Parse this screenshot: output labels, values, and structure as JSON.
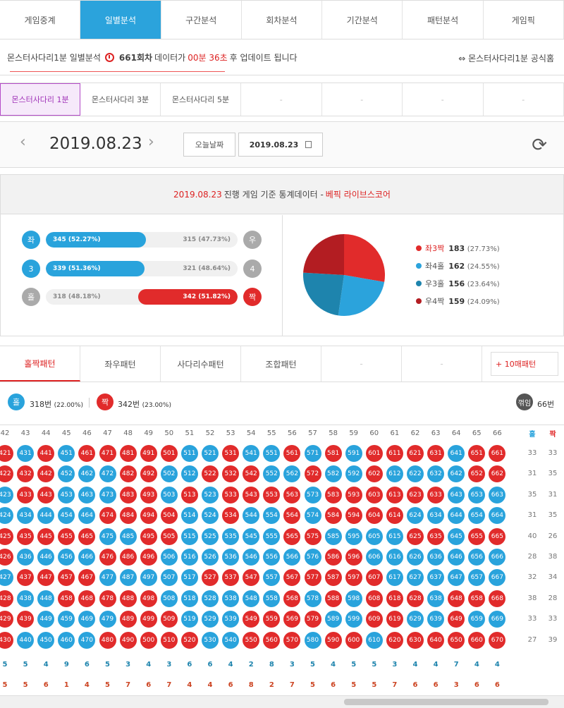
{
  "tabs": [
    "게임중계",
    "일별분석",
    "구간분석",
    "회차분석",
    "기간분석",
    "패턴분석",
    "게임픽"
  ],
  "active_tab": 1,
  "notice": {
    "prefix": "몬스터사다리1분 일별분석",
    "round": "661회차",
    "mid": "데이터가",
    "time": "00분 36초",
    "suffix": "후 업데이트 됩니다",
    "home": "몬스터사다리1분 공식홈"
  },
  "ladders": [
    "몬스터사다리 1분",
    "몬스터사다리 3분",
    "몬스터사다리 5분",
    "-",
    "-",
    "-",
    "-"
  ],
  "date": {
    "current": "2019.08.23",
    "today_button": "오늘날짜",
    "picker_value": "2019.08.23"
  },
  "stats": {
    "head_date": "2019.08.23",
    "head_text": "진행 게임 기준 통계데이터 -",
    "head_brand": "베픽 라이브스코어",
    "rows": [
      {
        "left_label": "좌",
        "right_label": "우",
        "left_text": "345 (52.27%)",
        "right_text": "315 (47.73%)",
        "left_pct": 52.27,
        "winner": "left",
        "color": "#29a3dc"
      },
      {
        "left_label": "3",
        "right_label": "4",
        "left_text": "339 (51.36%)",
        "right_text": "321 (48.64%)",
        "left_pct": 51.36,
        "winner": "left",
        "color": "#29a3dc"
      },
      {
        "left_label": "홀",
        "right_label": "짝",
        "left_text": "318 (48.18%)",
        "right_text": "342 (51.82%)",
        "left_pct": 48.18,
        "winner": "right",
        "color": "#e12b2b"
      }
    ],
    "legend": [
      {
        "label": "좌3짝",
        "value": "183",
        "pct": "(27.73%)",
        "color": "#e12b2b",
        "share": 27.73
      },
      {
        "label": "좌4홀",
        "value": "162",
        "pct": "(24.55%)",
        "color": "#2ba3dc",
        "share": 24.55
      },
      {
        "label": "우3홀",
        "value": "156",
        "pct": "(23.64%)",
        "color": "#1e84ad",
        "share": 23.64
      },
      {
        "label": "우4짝",
        "value": "159",
        "pct": "(24.09%)",
        "color": "#b31d22",
        "share": 24.09
      }
    ]
  },
  "pattern_tabs": [
    "홀짝패턴",
    "좌우패턴",
    "사다리수패턴",
    "조합패턴",
    "-",
    "-"
  ],
  "pattern_more": "+ 10매패턴",
  "summary": {
    "odd_label": "홀",
    "odd_text": "318번",
    "odd_pct": "(22.00%)",
    "even_label": "짝",
    "even_text": "342번",
    "even_pct": "(23.00%)",
    "break_label": "꺾임",
    "break_count": "66번"
  },
  "grid": {
    "cols": [
      "42",
      "43",
      "44",
      "45",
      "46",
      "47",
      "48",
      "49",
      "50",
      "51",
      "52",
      "53",
      "54",
      "55",
      "56",
      "57",
      "58",
      "59",
      "60",
      "61",
      "62",
      "63",
      "64",
      "65",
      "66"
    ],
    "odd_head": "홀",
    "even_head": "짝",
    "odd_counts": [
      "33",
      "31",
      "35",
      "31",
      "40",
      "28",
      "32",
      "38",
      "33",
      "27"
    ],
    "even_counts": [
      "33",
      "35",
      "31",
      "35",
      "26",
      "38",
      "34",
      "28",
      "33",
      "39"
    ],
    "bottom_odd": [
      "5",
      "5",
      "4",
      "9",
      "6",
      "5",
      "3",
      "4",
      "3",
      "6",
      "6",
      "4",
      "2",
      "8",
      "3",
      "5",
      "4",
      "5",
      "5",
      "3",
      "4",
      "4",
      "7",
      "4",
      "4"
    ],
    "bottom_even": [
      "5",
      "5",
      "6",
      "1",
      "4",
      "5",
      "7",
      "6",
      "7",
      "4",
      "4",
      "6",
      "8",
      "2",
      "7",
      "5",
      "6",
      "5",
      "5",
      "7",
      "6",
      "6",
      "3",
      "6",
      "6"
    ],
    "rows": [
      "RBRBRRRRRBBRBBRBRBRRRRBRR",
      "RRRBBBRRBBRRRBBRBBRBBBBRR",
      "BRRBBBRRBRBRRRRBRRRRRRBBB",
      "BBBBBRRRRBBRBBRBRRRRBBBBB",
      "RRRRRBBRRBBBBBRRBBBBRRBRR",
      "RBBBBRRRBBBBBBBBRRBBBBBBB",
      "BRRRRBBBBBRRRBRRRRRBBBBBB",
      "RBBRRRRRBBBBBBRBRBRRRBRRR",
      "RRBBBBRRRBBBRRRRBBRRBBRBB",
      "RBBBBRRRRRBBRRRBRRBRRRRRR"
    ]
  }
}
